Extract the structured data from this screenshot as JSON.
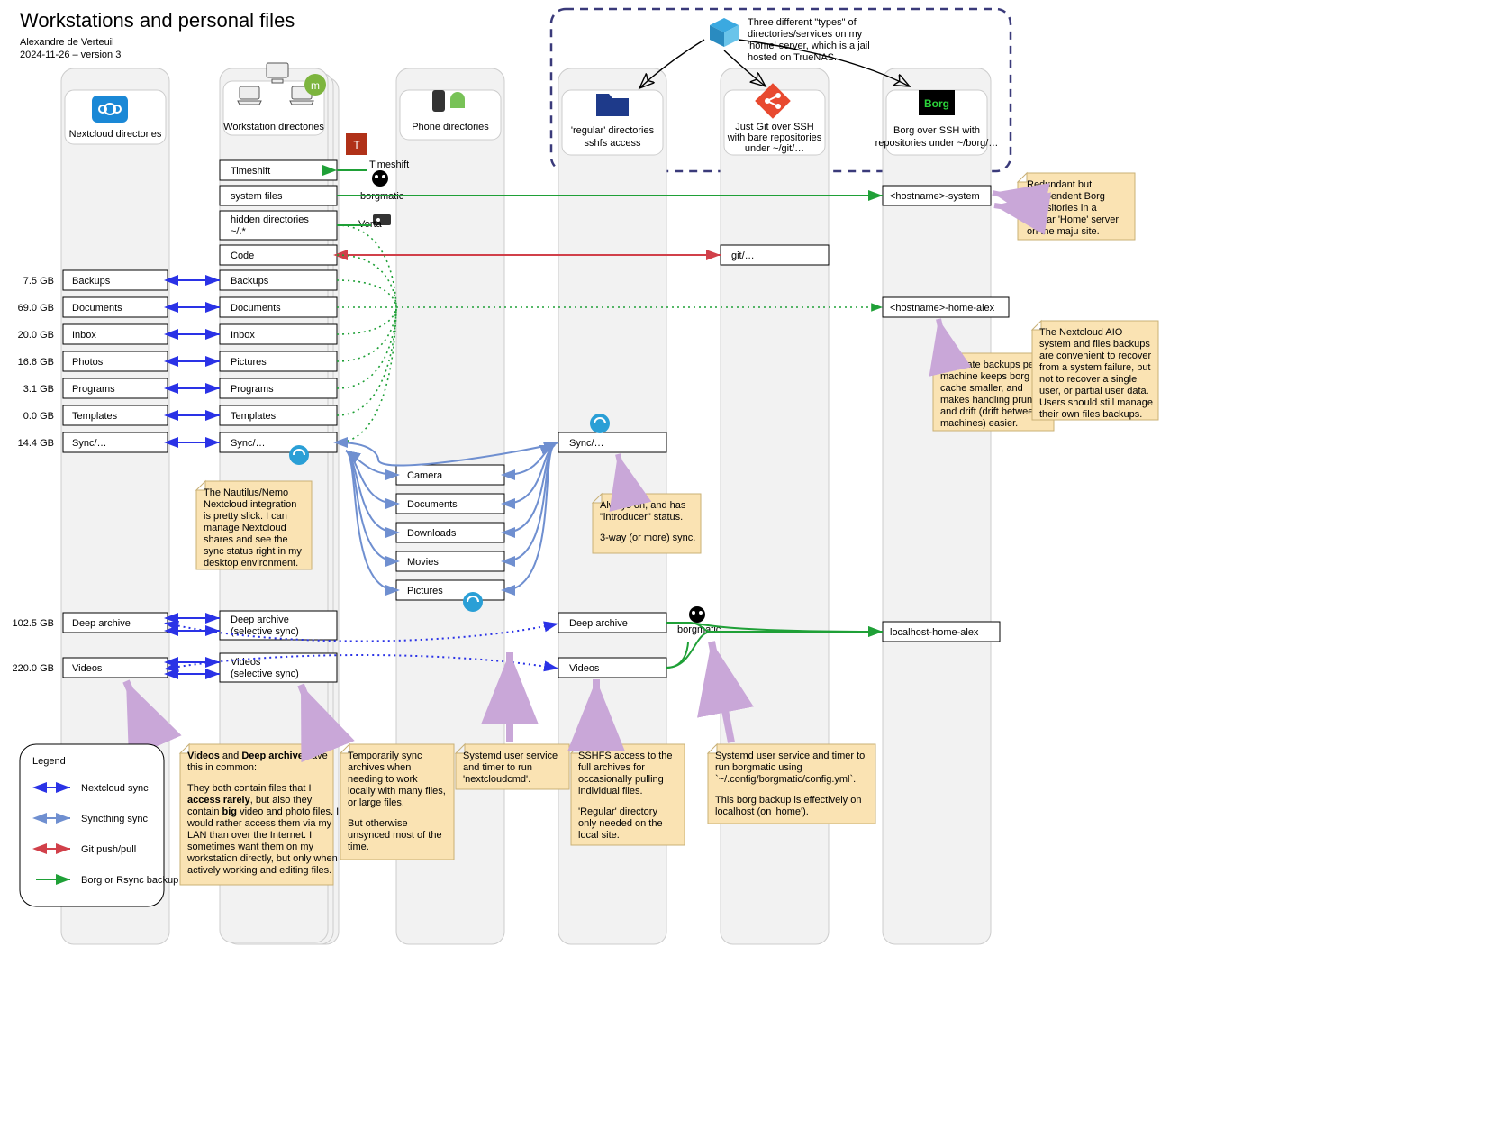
{
  "title": "Workstations and personal files",
  "author": "Alexandre de Verteuil",
  "date_version": "2024-11-26 – version 3",
  "lanes": {
    "nextcloud": "Nextcloud directories",
    "workstation": "Workstation directories",
    "phone": "Phone directories",
    "regular": "'regular' directories\nsshfs access",
    "git": "Just Git over SSH\nwith bare repositories\nunder ~/git/…",
    "borg": "Borg over SSH with\nrepositories under ~/borg/…"
  },
  "types_note": "Three different \"types\" of\ndirectories/services on my\n'home' server, which is a jail\nhosted on TrueNAS.",
  "ws_boxes": {
    "timeshift": "Timeshift",
    "system": "system files",
    "hidden": "hidden directories\n~/.*",
    "code": "Code",
    "backups": "Backups",
    "documents": "Documents",
    "inbox": "Inbox",
    "pictures": "Pictures",
    "programs": "Programs",
    "templates": "Templates",
    "sync": "Sync/…",
    "deep": "Deep archive\n(selective sync)",
    "videos": "Videos\n(selective sync)"
  },
  "nc_boxes": {
    "backups": "Backups",
    "documents": "Documents",
    "inbox": "Inbox",
    "photos": "Photos",
    "programs": "Programs",
    "templates": "Templates",
    "sync": "Sync/…",
    "deep": "Deep archive",
    "videos": "Videos"
  },
  "sizes": {
    "backups": "7.5 GB",
    "documents": "69.0 GB",
    "inbox": "20.0 GB",
    "photos": "16.6 GB",
    "programs": "3.1 GB",
    "templates": "0.0 GB",
    "sync": "14.4 GB",
    "deep": "102.5 GB",
    "videos": "220.0 GB"
  },
  "phone_boxes": {
    "camera": "Camera",
    "documents": "Documents",
    "downloads": "Downloads",
    "movies": "Movies",
    "pictures": "Pictures"
  },
  "regular_boxes": {
    "sync": "Sync/…",
    "deep": "Deep archive",
    "videos": "Videos"
  },
  "git_box": "git/…",
  "borg_boxes": {
    "system": "<hostname>-system",
    "homealex": "<hostname>-home-alex",
    "localhost": "localhost-home-alex"
  },
  "tool_labels": {
    "timeshift": "Timeshift",
    "borgmatic": "borgmatic",
    "vorta": "Vorta",
    "borgmatic2": "borgmatic"
  },
  "notes": {
    "redundant": "Redundant but\nindependent Borg\nrepositories in a\nsimilar 'Home' server\non the maju site.",
    "nautilus": "The Nautilus/Nemo\nNextcloud integration\nis pretty slick. I can\nmanage Nextcloud\nshares and see the\nsync status right in my\ndesktop environment.",
    "intro": "Always on, and has\n\"introducer\" status.\n\n3-way (or more) sync.",
    "separate": "Separate backups per\nmachine keeps borg\ncache smaller, and\nmakes handling pruning\nand drift (drift between\nmachines) easier.",
    "aio": "The Nextcloud AIO\nsystem and files backups\nare convenient to recover\nfrom a system failure, but\nnot to recover a single\nuser, or partial user data.\nUsers should still manage\ntheir own files backups.",
    "videos_deep": "Videos and Deep archive have\nthis in common:\n\nThey both contain files that I\naccess rarely, but also they\ncontain big video and photo files. I\nwould rather access them via my\nLAN than over the Internet. I\nsometimes want them on my\nworkstation directly, but only when\nactively working and editing files.",
    "temp_sync": "Temporarily sync\narchives when\nneeding to work\nlocally with many files,\nor large files.\n\nBut otherwise\nunsynced most of the\ntime.",
    "systemd_nc": "Systemd user service\nand timer to run\n'nextcloudcmd'.",
    "sshfs": "SSHFS access to the\nfull archives for\noccasionally pulling\nindividual files.\n\n'Regular' directory\nonly needed on the\nlocal site.",
    "systemd_borg": "Systemd user service and timer to\nrun borgmatic using\n`~/.config/borgmatic/config.yml`.\n\nThis borg backup is effectively on\nlocalhost (on 'home')."
  },
  "legend": {
    "title": "Legend",
    "nc": "Nextcloud sync",
    "st": "Syncthing sync",
    "git": "Git push/pull",
    "borg": "Borg or Rsync backup"
  },
  "colors": {
    "nc": "#2a32e6",
    "st": "#6f8fd0",
    "git": "#d1404a",
    "borg": "#1fa037",
    "note_arrow": "#c9a7d8",
    "dashed": "#3a3a7a"
  }
}
